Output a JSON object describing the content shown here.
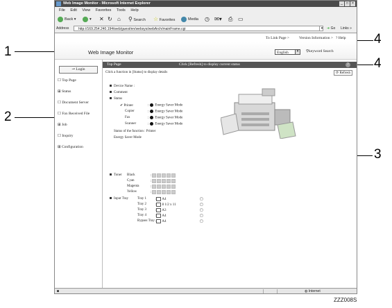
{
  "window": {
    "title": "Web Image Monitor - Microsoft Internet Explorer"
  },
  "menu": [
    "File",
    "Edit",
    "View",
    "Favorites",
    "Tools",
    "Help"
  ],
  "toolbar": {
    "back": "Back",
    "search": "Search",
    "favorites": "Favorites",
    "media": "Media"
  },
  "address": {
    "label": "Address",
    "url": "http://169.254.240.194/web/guest/en/websys/webArch/mainFrame.cgi",
    "go": "Go",
    "links": "Links"
  },
  "toplinks": {
    "link_page": "To Link Page >",
    "version": "Version Information >",
    "help": "Help"
  },
  "header": {
    "brand": "Web Image Monitor",
    "language": "English",
    "keyword_search": "keyword Search"
  },
  "sidebar": {
    "login": "Login",
    "items": [
      "Top Page",
      "Status",
      "Document Server",
      "Fax Received File",
      "Job",
      "Inquiry",
      "Configuration"
    ]
  },
  "bar": {
    "title": "Top Page",
    "hint": "Click [Refresh] to display current status"
  },
  "content": {
    "instruction": "Click a function in [Status] to display details",
    "refresh": "Refresh",
    "device_name": "Device Name :",
    "comment": "Comment",
    "status": "Status",
    "functions": [
      {
        "name": "Printer",
        "state": "Energy Saver Mode"
      },
      {
        "name": "Copier",
        "state": "Energy Saver Mode"
      },
      {
        "name": "Fax",
        "state": "Energy Saver Mode"
      },
      {
        "name": "Scanner",
        "state": "Energy Saver Mode"
      }
    ],
    "status_of_function": "Status of the function : Printer",
    "status_detail": "Energy Saver Mode",
    "toner_label": "Toner",
    "toner": [
      "Black",
      "Cyan",
      "Magenta",
      "Yellow"
    ],
    "input_tray_label": "Input Tray",
    "trays": [
      {
        "name": "Tray 1",
        "size": "A4"
      },
      {
        "name": "Tray 2",
        "size": "8 1/2 x 11"
      },
      {
        "name": "Tray 3",
        "size": "A3"
      },
      {
        "name": "Tray 4",
        "size": "A4"
      },
      {
        "name": "Bypass Tray",
        "size": "A4"
      }
    ]
  },
  "statusbar": {
    "zone": "Internet"
  },
  "callouts": [
    "1",
    "2",
    "3",
    "4",
    "4"
  ],
  "figure_code": "ZZZ008S"
}
